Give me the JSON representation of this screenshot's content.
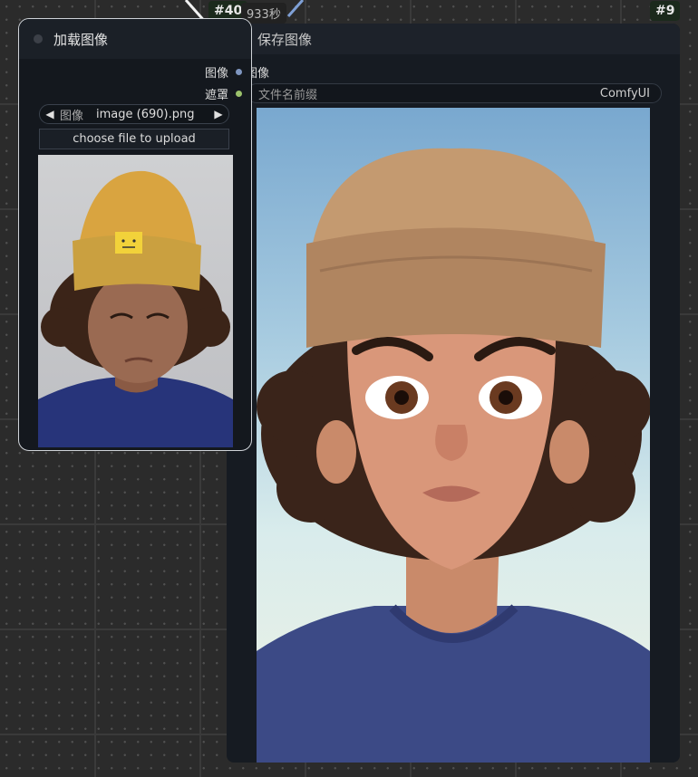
{
  "canvas": {
    "timer_text": "933秒"
  },
  "load_node": {
    "id_badge": "#40",
    "title": "加载图像",
    "outputs": [
      {
        "label": "图像",
        "color": "#7f96c0"
      },
      {
        "label": "遮罩",
        "color": "#9cc26c"
      }
    ],
    "image_picker": {
      "label": "图像",
      "value": "image (690).png"
    },
    "upload_label": "choose file to upload"
  },
  "save_node": {
    "id_badge": "#9",
    "title": "保存图像",
    "input_label": "图像",
    "filename_prefix": {
      "label": "文件名前缀",
      "value": "ComfyUI"
    }
  },
  "colors": {
    "node_bg": "#161b22",
    "selected_outline": "#cfd3d8",
    "image_slot": "#7f96c0",
    "mask_slot": "#9cc26c"
  }
}
